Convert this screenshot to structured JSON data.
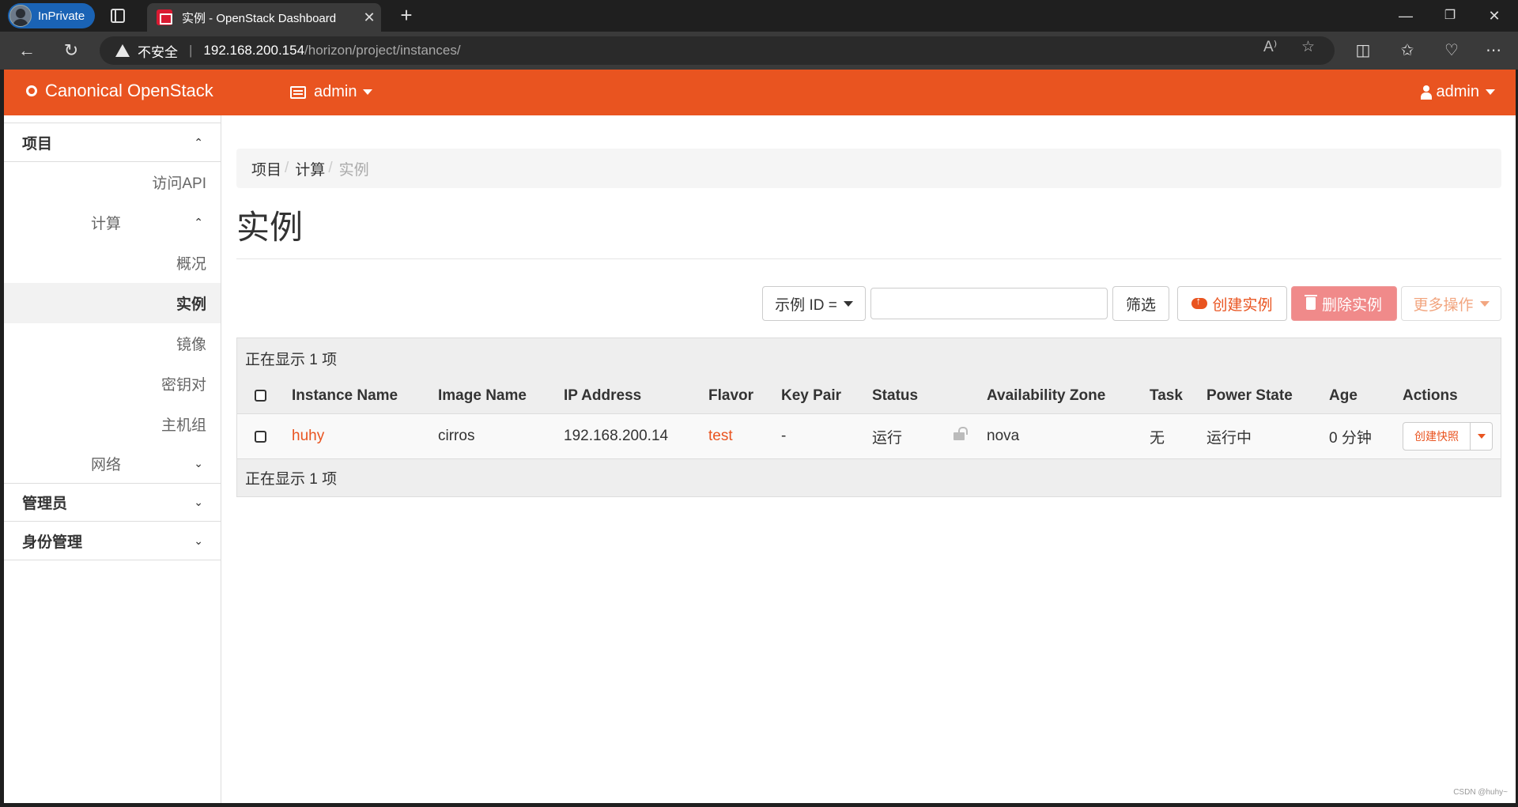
{
  "browser": {
    "inprivate_label": "InPrivate",
    "tab_title": "实例 - OpenStack Dashboard",
    "tab_close": "✕",
    "new_tab": "+",
    "minimize": "—",
    "restore": "❐",
    "close": "✕",
    "security_label": "不安全",
    "url_host": "192.168.200.154",
    "url_path": "/horizon/project/instances/"
  },
  "topnav": {
    "brand": "Canonical OpenStack",
    "project": "admin",
    "user": "admin"
  },
  "sidebar": {
    "sections": [
      {
        "label": "项目",
        "chevron": "⌃"
      },
      {
        "label": "管理员",
        "chevron": "⌄"
      },
      {
        "label": "身份管理",
        "chevron": "⌄"
      }
    ],
    "api_access": "访问API",
    "compute": {
      "label": "计算",
      "chevron": "⌃"
    },
    "compute_items": [
      "概况",
      "实例",
      "镜像",
      "密钥对",
      "主机组"
    ],
    "network": {
      "label": "网络",
      "chevron": "⌄"
    }
  },
  "breadcrumb": {
    "items": [
      "项目",
      "计算",
      "实例"
    ],
    "sep": "/"
  },
  "page_title": "实例",
  "toolbar": {
    "filter_field": "示例 ID =",
    "filter_value": "",
    "filter_button": "筛选",
    "create_button": "创建实例",
    "delete_button": "删除实例",
    "more_button": "更多操作"
  },
  "table": {
    "summary_top": "正在显示 1 项",
    "summary_bottom": "正在显示 1 项",
    "columns": [
      "Instance Name",
      "Image Name",
      "IP Address",
      "Flavor",
      "Key Pair",
      "Status",
      "Availability Zone",
      "Task",
      "Power State",
      "Age",
      "Actions"
    ],
    "rows": [
      {
        "instance_name": "huhy",
        "image_name": "cirros",
        "ip_address": "192.168.200.14",
        "flavor": "test",
        "key_pair": "-",
        "status": "运行",
        "availability_zone": "nova",
        "task": "无",
        "power_state": "运行中",
        "age": "0 分钟",
        "action": "创建快照"
      }
    ]
  },
  "watermark": "CSDN @huhy~",
  "colors": {
    "accent": "#e95420",
    "danger": "#f08a8a"
  }
}
